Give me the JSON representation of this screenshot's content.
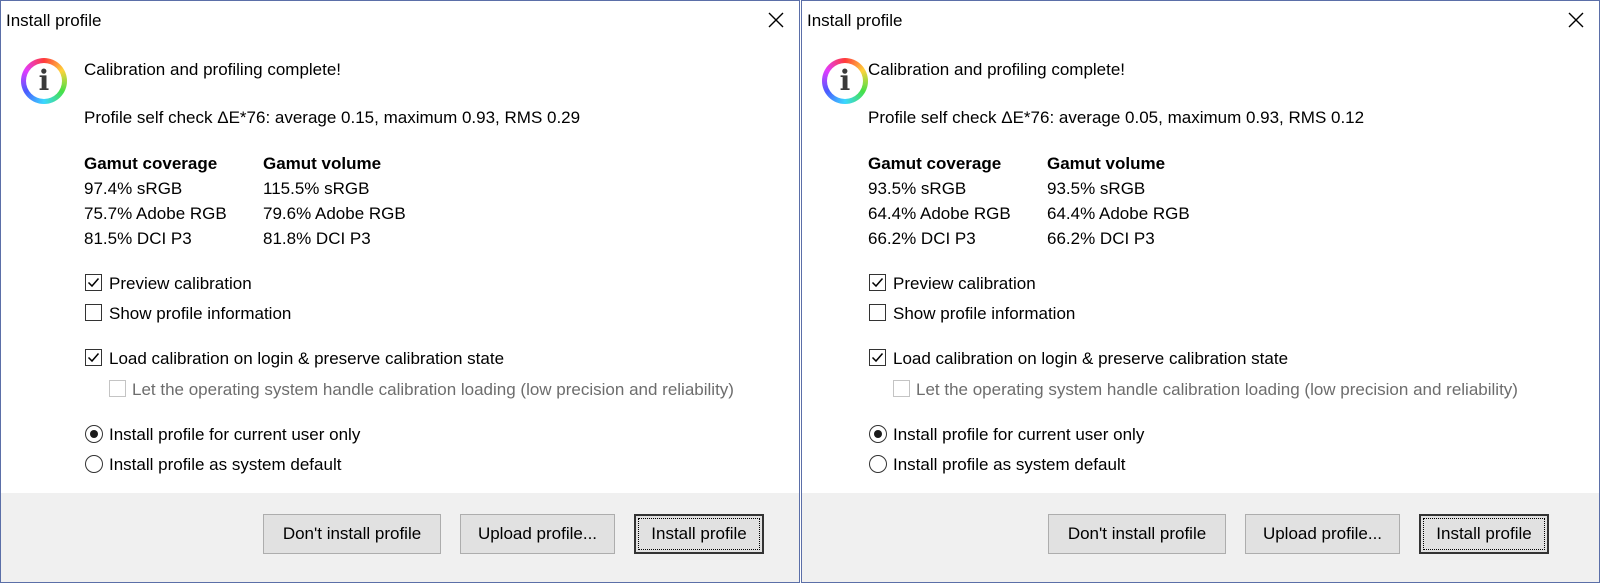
{
  "dialogs": [
    {
      "title": "Install profile",
      "message": "Calibration and profiling complete!",
      "self_check": "Profile self check ΔE*76: average 0.15, maximum 0.93, RMS 0.29",
      "gamut": {
        "coverage_header": "Gamut coverage",
        "volume_header": "Gamut volume",
        "coverage": [
          "97.4% sRGB",
          "75.7% Adobe RGB",
          "81.5% DCI P3"
        ],
        "volume": [
          "115.5% sRGB",
          "79.6% Adobe RGB",
          "81.8% DCI P3"
        ]
      },
      "options": {
        "preview_calibration": "Preview calibration",
        "show_profile_information": "Show profile information",
        "load_calibration": "Load calibration on login & preserve calibration state",
        "os_handle_loading": "Let the operating system handle calibration loading (low precision and reliability)",
        "install_current_user": "Install profile for current user only",
        "install_system_default": "Install profile as system default"
      },
      "buttons": {
        "dont_install": "Don't install profile",
        "upload": "Upload profile...",
        "install": "Install profile"
      }
    },
    {
      "title": "Install profile",
      "message": "Calibration and profiling complete!",
      "self_check": "Profile self check ΔE*76: average 0.05, maximum 0.93, RMS 0.12",
      "gamut": {
        "coverage_header": "Gamut coverage",
        "volume_header": "Gamut volume",
        "coverage": [
          "93.5% sRGB",
          "64.4% Adobe RGB",
          "66.2% DCI P3"
        ],
        "volume": [
          "93.5% sRGB",
          "64.4% Adobe RGB",
          "66.2% DCI P3"
        ]
      },
      "options": {
        "preview_calibration": "Preview calibration",
        "show_profile_information": "Show profile information",
        "load_calibration": "Load calibration on login & preserve calibration state",
        "os_handle_loading": "Let the operating system handle calibration loading (low precision and reliability)",
        "install_current_user": "Install profile for current user only",
        "install_system_default": "Install profile as system default"
      },
      "buttons": {
        "dont_install": "Don't install profile",
        "upload": "Upload profile...",
        "install": "Install profile"
      }
    }
  ],
  "state": {
    "preview_calibration_checked": true,
    "show_profile_information_checked": false,
    "load_calibration_checked": true,
    "os_handle_loading_checked": false,
    "os_handle_loading_enabled": false,
    "selected_install_scope": "current_user"
  },
  "icons": {
    "info": "info-icon",
    "close": "close-icon",
    "checkmark": "checkmark-icon"
  },
  "colors": {
    "window_border": "#5b6fa8",
    "footer_bg": "#f0f0f0",
    "button_bg": "#e1e1e1",
    "disabled_text": "#6d6d6d"
  }
}
